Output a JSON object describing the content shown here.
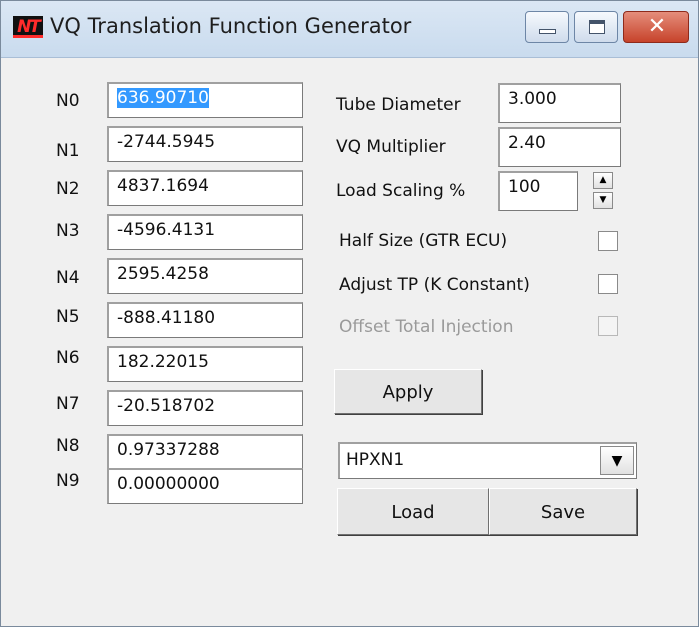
{
  "window": {
    "title": "VQ Translation Function Generator",
    "app_icon_text": "NT",
    "close_glyph": "✕"
  },
  "coefficients": [
    {
      "label": "N0",
      "value": "636.90710"
    },
    {
      "label": "N1",
      "value": "-2744.5945"
    },
    {
      "label": "N2",
      "value": "4837.1694"
    },
    {
      "label": "N3",
      "value": "-4596.4131"
    },
    {
      "label": "N4",
      "value": "2595.4258"
    },
    {
      "label": "N5",
      "value": "-888.41180"
    },
    {
      "label": "N6",
      "value": "182.22015"
    },
    {
      "label": "N7",
      "value": "-20.518702"
    },
    {
      "label": "N8",
      "value": "0.97337288"
    },
    {
      "label": "N9",
      "value": "0.00000000"
    }
  ],
  "settings": {
    "tube_diameter_label": "Tube Diameter",
    "tube_diameter_value": "3.000",
    "vq_multiplier_label": "VQ Multiplier",
    "vq_multiplier_value": "2.40",
    "load_scaling_label": "Load Scaling %",
    "load_scaling_value": "100",
    "spin_up": "▲",
    "spin_down": "▼",
    "half_size_label": "Half Size (GTR ECU)",
    "adjust_tp_label": "Adjust TP (K Constant)",
    "offset_label": "Offset Total Injection"
  },
  "actions": {
    "apply": "Apply",
    "preset": "HPXN1",
    "dropdown_glyph": "▼",
    "load": "Load",
    "save": "Save"
  }
}
